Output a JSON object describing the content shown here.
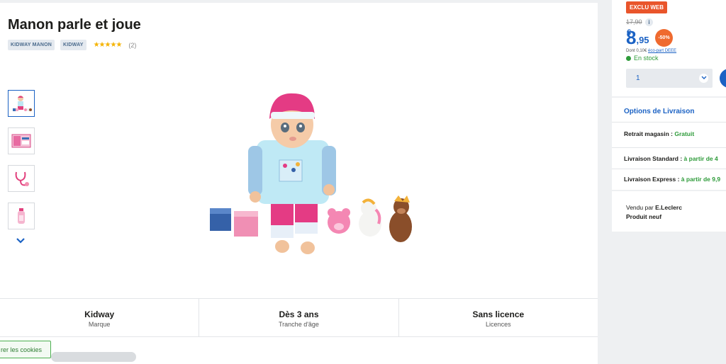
{
  "product": {
    "title": "Manon parle et joue",
    "chips": [
      "KIDWAY MANON",
      "KIDWAY"
    ],
    "stars": "★★★★★",
    "rating_count": "(2)"
  },
  "features": [
    {
      "value": "Kidway",
      "label": "Marque"
    },
    {
      "value": "Dès 3 ans",
      "label": "Tranche d'âge"
    },
    {
      "value": "Sans licence",
      "label": "Licences"
    }
  ],
  "cookie": {
    "label": "rer les cookies"
  },
  "offer": {
    "badge": "EXCLU WEB",
    "old_price": "17,90",
    "info_icon": "i",
    "price_int": "8",
    "price_cur": "€",
    "price_dec": ",95",
    "discount": "-50%",
    "eco_prefix": "Dont 0,10€ ",
    "eco_link": "éco-part DEEE",
    "stock": "En stock",
    "qty": "1"
  },
  "delivery": {
    "title": "Options de Livraison",
    "pickup_label": "Retrait magasin : ",
    "pickup_value": "Gratuit",
    "standard_label": "Livraison Standard : ",
    "standard_value": "à partir de 4",
    "express_label": "Livraison Express : ",
    "express_value": "à partir de 9,9"
  },
  "seller": {
    "prefix": "Vendu par ",
    "name": "E.Leclerc",
    "condition": "Produit neuf"
  },
  "colors": {
    "accent": "#1b62c4",
    "orange": "#e9552b",
    "green": "#2e9b3a"
  }
}
